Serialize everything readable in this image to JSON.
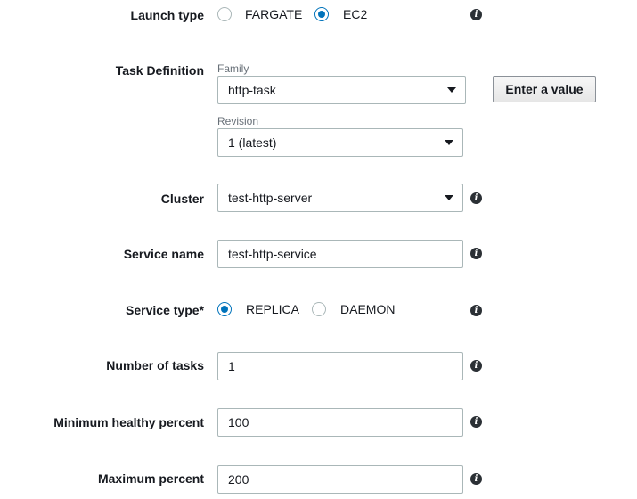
{
  "launch_type": {
    "label": "Launch type",
    "options": [
      "FARGATE",
      "EC2"
    ],
    "selected": "EC2"
  },
  "task_definition": {
    "label": "Task Definition",
    "family_label": "Family",
    "family_value": "http-task",
    "revision_label": "Revision",
    "revision_value": "1 (latest)",
    "enter_value_button": "Enter a value"
  },
  "cluster": {
    "label": "Cluster",
    "value": "test-http-server"
  },
  "service_name": {
    "label": "Service name",
    "value": "test-http-service"
  },
  "service_type": {
    "label": "Service type*",
    "options": [
      "REPLICA",
      "DAEMON"
    ],
    "selected": "REPLICA"
  },
  "number_of_tasks": {
    "label": "Number of tasks",
    "value": "1"
  },
  "min_healthy_percent": {
    "label": "Minimum healthy percent",
    "value": "100"
  },
  "max_percent": {
    "label": "Maximum percent",
    "value": "200"
  },
  "icons": {
    "info": "info-icon",
    "dropdown": "chevron-down-icon"
  },
  "colors": {
    "radio_selected": "#0073bb",
    "border": "#aab7b8"
  }
}
